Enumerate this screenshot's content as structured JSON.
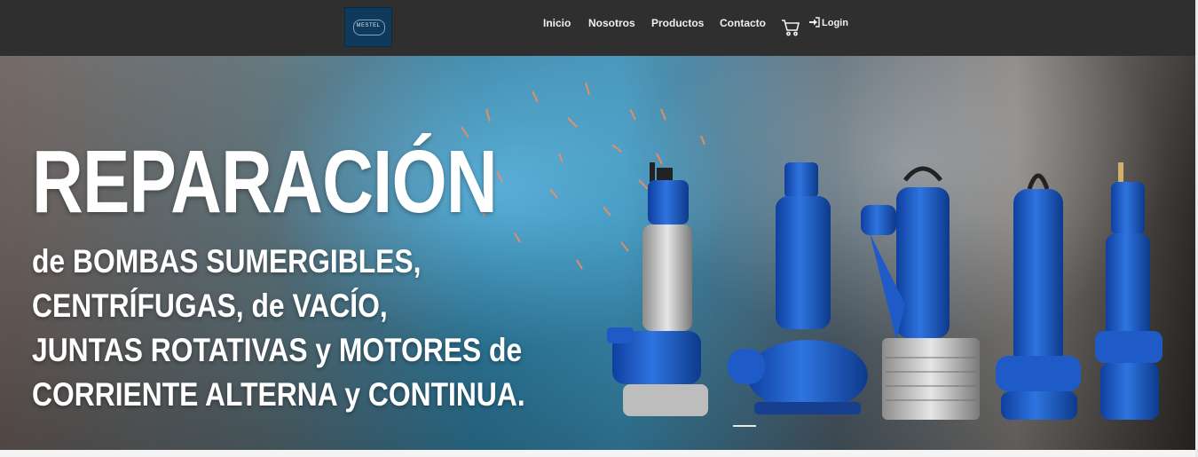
{
  "brand": {
    "logo_text": "MESTEL"
  },
  "nav": {
    "items": [
      {
        "label": "Inicio"
      },
      {
        "label": "Nosotros"
      },
      {
        "label": "Productos"
      },
      {
        "label": "Contacto"
      }
    ],
    "cart_icon": "shopping-cart-icon",
    "login_label": "Login",
    "login_icon": "sign-in-icon"
  },
  "hero": {
    "title": "REPARACIÓN",
    "lines": [
      "de BOMBAS SUMERGIBLES,",
      "CENTRÍFUGAS, de VACÍO,",
      "JUNTAS ROTATIVAS y MOTORES de",
      "CORRIENTE ALTERNA y CONTINUA."
    ],
    "image_subject": "submersible-pumps-welding-background",
    "slides_indicator": "active"
  },
  "colors": {
    "navbar": "#2f2f2f",
    "logo_bg": "#0f3a5c",
    "pump_blue": "#1e5cc8",
    "hero_text": "#ffffff"
  }
}
